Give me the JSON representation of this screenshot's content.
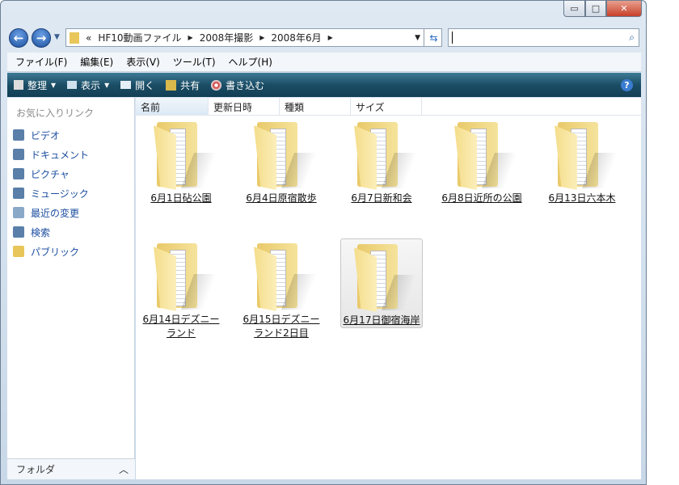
{
  "window": {
    "minimize": "▭",
    "maximize": "□",
    "close": "✕"
  },
  "address": {
    "overflow": "«",
    "crumbs": [
      "HF10動画ファイル",
      "2008年撮影",
      "2008年6月"
    ],
    "search_placeholder": ""
  },
  "menu": [
    "ファイル(F)",
    "編集(E)",
    "表示(V)",
    "ツール(T)",
    "ヘルプ(H)"
  ],
  "toolbar": {
    "organize": "整理",
    "views": "表示",
    "open": "開く",
    "share": "共有",
    "burn": "書き込む",
    "help": "?"
  },
  "sidebar": {
    "header": "お気に入りリンク",
    "links": [
      "ビデオ",
      "ドキュメント",
      "ピクチャ",
      "ミュージック",
      "最近の変更",
      "検索",
      "パブリック"
    ],
    "folders": "フォルダ"
  },
  "columns": [
    "名前",
    "更新日時",
    "種類",
    "サイズ"
  ],
  "items": [
    "6月1日砧公園",
    "6月4日原宿散歩",
    "6月7日新和会",
    "6月8日近所の公園",
    "6月13日六本木",
    "6月14日デズニーランド",
    "6月15日デズニーランド2日目",
    "6月17日御宿海岸"
  ]
}
